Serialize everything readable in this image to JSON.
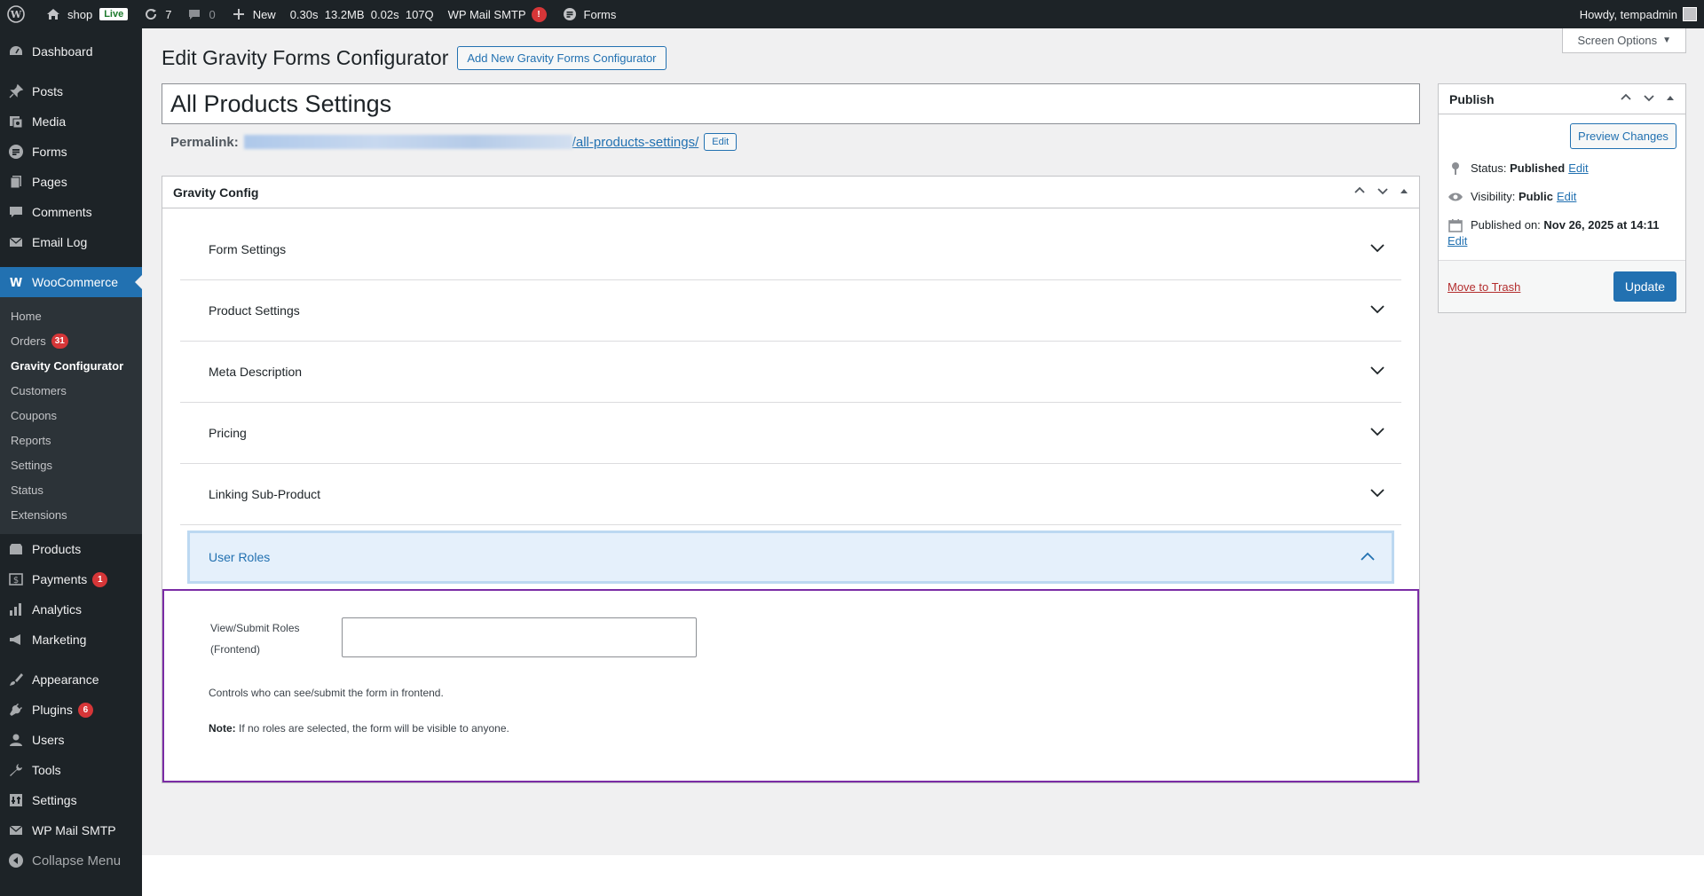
{
  "adminbar": {
    "site_name": "shop",
    "live_label": "Live",
    "updates_count": "7",
    "comments_count": "0",
    "new_label": "New",
    "perf_time": "0.30s",
    "perf_mem": "13.2MB",
    "perf_query_time": "0.02s",
    "perf_queries": "107Q",
    "smtp_label": "WP Mail SMTP",
    "smtp_badge": "!",
    "forms_label": "Forms",
    "howdy": "Howdy, tempadmin"
  },
  "sidebar": {
    "dashboard": "Dashboard",
    "posts": "Posts",
    "media": "Media",
    "forms": "Forms",
    "pages": "Pages",
    "comments": "Comments",
    "email_log": "Email Log",
    "woocommerce": "WooCommerce",
    "woo_sub": {
      "home": "Home",
      "orders": "Orders",
      "orders_badge": "31",
      "gravity_configurator": "Gravity Configurator",
      "customers": "Customers",
      "coupons": "Coupons",
      "reports": "Reports",
      "settings": "Settings",
      "status": "Status",
      "extensions": "Extensions"
    },
    "products": "Products",
    "payments": "Payments",
    "payments_badge": "1",
    "analytics": "Analytics",
    "marketing": "Marketing",
    "appearance": "Appearance",
    "plugins": "Plugins",
    "plugins_badge": "6",
    "users": "Users",
    "tools": "Tools",
    "settings": "Settings",
    "wp_mail_smtp": "WP Mail SMTP",
    "collapse": "Collapse Menu"
  },
  "main": {
    "screen_options": "Screen Options",
    "page_title": "Edit Gravity Forms Configurator",
    "add_new": "Add New Gravity Forms Configurator",
    "post_title": "All Products Settings",
    "permalink_label": "Permalink:",
    "permalink_slug": "/all-products-settings/",
    "permalink_edit": "Edit"
  },
  "gravity_config": {
    "title": "Gravity Config",
    "sections": [
      "Form Settings",
      "Product Settings",
      "Meta Description",
      "Pricing",
      "Linking Sub-Product",
      "User Roles"
    ],
    "user_roles": {
      "field_label_line1": "View/Submit Roles",
      "field_label_line2": "(Frontend)",
      "field_value": "",
      "help": "Controls who can see/submit the form in frontend.",
      "note_label": "Note:",
      "note_text": " If no roles are selected, the form will be visible to anyone."
    }
  },
  "publish": {
    "title": "Publish",
    "preview": "Preview Changes",
    "status_label": "Status:",
    "status_value": "Published",
    "visibility_label": "Visibility:",
    "visibility_value": "Public",
    "published_label": "Published on:",
    "published_value": "Nov 26, 2025 at 14:11",
    "edit": "Edit",
    "trash": "Move to Trash",
    "update": "Update"
  },
  "colors": {
    "accent": "#2271b1",
    "adminbar_bg": "#1d2327",
    "badge_red": "#d63638",
    "focus_border": "#7b2ca5"
  }
}
